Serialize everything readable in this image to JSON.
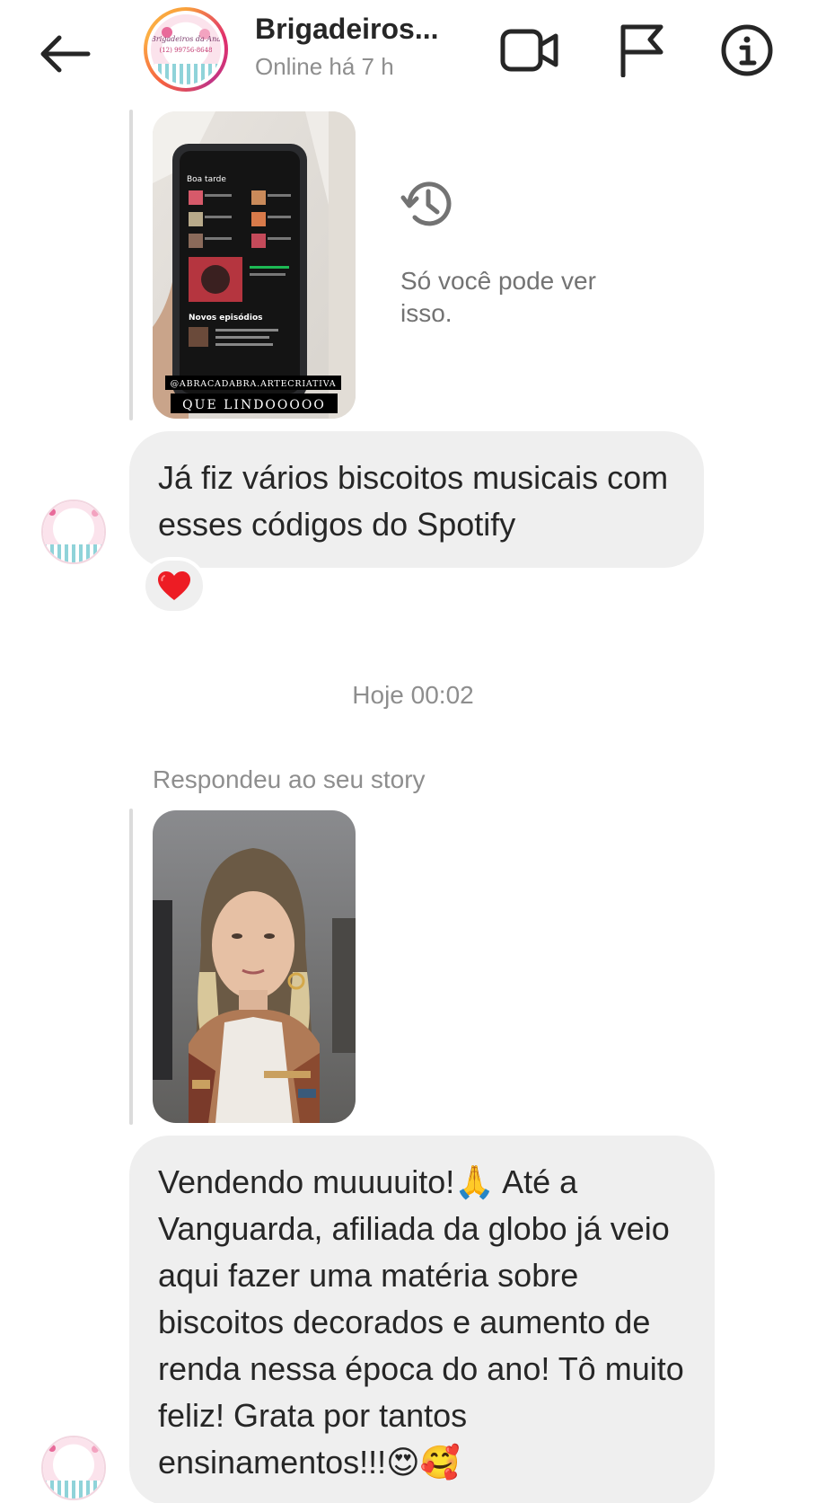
{
  "header": {
    "title": "Brigadeiros...",
    "status": "Online há 7 h",
    "logo_text_1": "Brigadeiros da Ana",
    "logo_text_2": "(12) 99756-8648"
  },
  "messages": {
    "story1": {
      "screen_time": "Boa tarde",
      "screen_section": "Novos episódios",
      "caption_handle": "@ABRACADABRA.ARTECRIATIVA",
      "caption_text": "QUE LINDOOOOO",
      "only_you_text": "Só você pode ver isso."
    },
    "bubble1": {
      "text": "Já fiz vários biscoitos musicais com esses códigos do Spotify"
    },
    "reaction1": {
      "emoji": "❤️"
    },
    "time_separator": "Hoje 00:02",
    "story2": {
      "label": "Respondeu ao seu story"
    },
    "bubble2": {
      "text": "Vendendo muuuuito!🙏 Até a Vanguarda, afiliada da globo já veio aqui fazer uma matéria sobre biscoitos decorados e aumento de renda nessa época do ano! Tô muito feliz! Grata por tantos ensinamentos!!!😍🥰"
    }
  },
  "icons": {
    "back": "arrow-left-icon",
    "video": "video-camera-icon",
    "flag": "flag-icon",
    "info": "info-icon",
    "history": "history-icon"
  },
  "colors": {
    "bubble": "#efefef",
    "muted_text": "#8e8e8e",
    "heart": "#ed1c24"
  }
}
